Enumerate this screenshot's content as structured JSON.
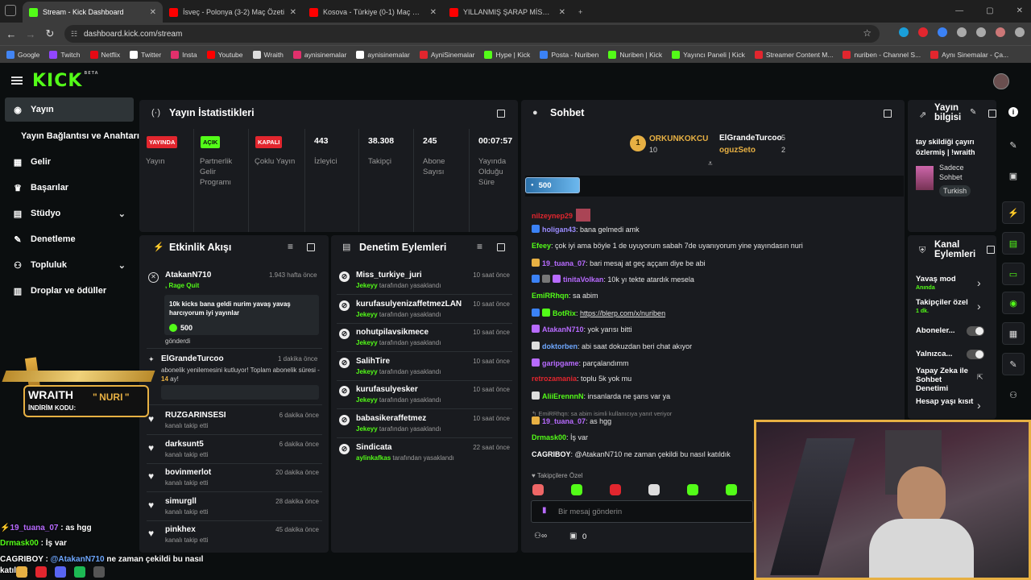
{
  "browser": {
    "tabs": [
      {
        "title": "Stream - Kick Dashboard",
        "active": true,
        "favicon": "kick-icon",
        "color": "#53fc18"
      },
      {
        "title": "İsveç - Polonya (3-2) Maç Özeti",
        "active": false,
        "favicon": "youtube-icon",
        "color": "#ff0000"
      },
      {
        "title": "Kosova - Türkiye (0-1) Maç Özeti",
        "active": false,
        "favicon": "youtube-icon",
        "color": "#ff0000"
      },
      {
        "title": "YILLANMIŞ ŞARAP MİSALİ.. | LOL",
        "active": false,
        "favicon": "youtube-icon",
        "color": "#ff0000"
      }
    ],
    "url": "dashboard.kick.com/stream",
    "bookmarks": [
      "Google",
      "Twitch",
      "Netflix",
      "Twitter",
      "Insta",
      "Youtube",
      "Wraith",
      "aynisinemalar",
      "aynisinemalar",
      "AyniSinemalar",
      "Hype | Kick",
      "Posta - Nuriben",
      "Nuriben | Kick",
      "Yayıncı Paneli | Kick",
      "Streamer Content M...",
      "nuriben - Channel S...",
      "Aynı Sinemalar - Ça..."
    ]
  },
  "kick": {
    "logo": "KICK",
    "logo_tag": "BETA",
    "accent": "#53fc18"
  },
  "sidebar": {
    "items": [
      {
        "label": "Yayın",
        "icon": "broadcast-icon",
        "active": true
      },
      {
        "label": "Yayın Bağlantısı ve Anahtarı",
        "icon": "",
        "active": false
      },
      {
        "label": "Gelir",
        "icon": "dollar-icon",
        "active": false
      },
      {
        "label": "Başarılar",
        "icon": "trophy-icon",
        "active": false
      },
      {
        "label": "Stüdyo",
        "icon": "studio-icon",
        "active": false,
        "chevron": true
      },
      {
        "label": "Denetleme",
        "icon": "wrench-icon",
        "active": false
      },
      {
        "label": "Topluluk",
        "icon": "community-icon",
        "active": false,
        "chevron": true
      },
      {
        "label": "Droplar ve ödüller",
        "icon": "drops-icon",
        "active": false
      }
    ]
  },
  "stats": {
    "title": "Yayın İstatistikleri",
    "cols": [
      {
        "value": "YAYINDA",
        "label": "Yayın",
        "type": "badge",
        "color": "#e2262e"
      },
      {
        "value": "AÇIK",
        "label": "Partnerlik Gelir Programı",
        "type": "badge",
        "color": "#53fc18"
      },
      {
        "value": "KAPALI",
        "label": "Çoklu Yayın",
        "type": "badge",
        "color": "#e2262e"
      },
      {
        "value": "443",
        "label": "İzleyici",
        "type": "num"
      },
      {
        "value": "38.308",
        "label": "Takipçi",
        "type": "num"
      },
      {
        "value": "245",
        "label": "Abone Sayısı",
        "type": "num"
      },
      {
        "value": "00:07:57",
        "label": "Yayında Olduğu Süre",
        "type": "num"
      }
    ]
  },
  "activity": {
    "title": "Etkinlik Akışı",
    "items": [
      {
        "name": "AtakanN710",
        "time": "1.943 hafta önce",
        "sub": ", Rage Quit",
        "msg": "10k kicks bana geldi nurim yavaş yavaş harcıyorum iyi yayınlar",
        "amount": "500",
        "footer": "gönderdi"
      },
      {
        "name": "ElGrandeTurcoo",
        "time": "1 dakika önce",
        "sub": "abonelik yenilemesini kutluyor! Toplam abonelik süresi - ",
        "months": "14",
        "months_suffix": " ay!"
      },
      {
        "name": "RUZGARINSESI",
        "time": "6 dakika önce",
        "sub": "kanalı takip etti"
      },
      {
        "name": "darksunt5",
        "time": "6 dakika önce",
        "sub": "kanalı takip etti"
      },
      {
        "name": "bovinmerlot",
        "time": "20 dakika önce",
        "sub": "kanalı takip etti"
      },
      {
        "name": "simurgll",
        "time": "28 dakika önce",
        "sub": "kanalı takip etti"
      },
      {
        "name": "pinkhex",
        "time": "45 dakika önce",
        "sub": "kanalı takip etti"
      }
    ]
  },
  "moderation": {
    "title": "Denetim Eylemleri",
    "items": [
      {
        "name": "Miss_turkiye_juri",
        "time": "10 saat önce",
        "by": "Jekeyy",
        "action": " tarafından yasaklandı"
      },
      {
        "name": "kurufasulyenizaffetmezLAN",
        "time": "10 saat önce",
        "by": "Jekeyy",
        "action": " tarafından yasaklandı"
      },
      {
        "name": "nohutpilavsikmece",
        "time": "10 saat önce",
        "by": "Jekeyy",
        "action": " tarafından yasaklandı"
      },
      {
        "name": "SalihTire",
        "time": "10 saat önce",
        "by": "Jekeyy",
        "action": " tarafından yasaklandı"
      },
      {
        "name": "kurufasulyesker",
        "time": "10 saat önce",
        "by": "Jekeyy",
        "action": " tarafından yasaklandı"
      },
      {
        "name": "babasikeraffetmez",
        "time": "10 saat önce",
        "by": "Jekeyy",
        "action": " tarafından yasaklandı"
      },
      {
        "name": "Sindicata",
        "time": "22 saat önce",
        "by": "aylinkafkas",
        "action": " tarafından yasaklandı"
      }
    ]
  },
  "chat": {
    "title": "Sohbet",
    "leaders": [
      {
        "rank": "1",
        "name": "ORKUNKOKCU",
        "count": "10"
      },
      {
        "name": "ElGrandeTurcoo",
        "count": "5"
      },
      {
        "name": "oguzSeto",
        "count": "2"
      }
    ],
    "pinned_amount": "500",
    "messages": [
      {
        "user": "nilzeynep29",
        "color": "#e2262e",
        "text": ""
      },
      {
        "user": "holigan43",
        "color": "#9b8cff",
        "text": "bana gelmedi amk"
      },
      {
        "user": "Efeey",
        "color": "#53fc18",
        "text": "çok iyi ama böyle 1 de uyuyorum sabah 7de uyanıyorum yine yayındasın nuri"
      },
      {
        "user": "19_tuana_07",
        "color": "#b86bff",
        "text": "bari mesaj at geç aççam diye be abi"
      },
      {
        "user": "tinitaVolkan",
        "color": "#b86bff",
        "text": "10k yı tekte atardık mesela"
      },
      {
        "user": "EmiRRhqn",
        "color": "#53fc18",
        "text": "sa abim"
      },
      {
        "user": "BotRix",
        "color": "#53fc18",
        "text": "https://blerp.com/x/nuriben"
      },
      {
        "user": "AtakanN710",
        "color": "#b86bff",
        "text": "yok yarısı bitti"
      },
      {
        "user": "doktorben",
        "color": "#6fa8ff",
        "text": "abi saat dokuzdan beri chat akıyor"
      },
      {
        "user": "garipgame",
        "color": "#b86bff",
        "text": "parçalandımm"
      },
      {
        "user": "retrozamania",
        "color": "#e2262e",
        "text": "toplu 5k yok mu"
      },
      {
        "user": "AliiErennnN",
        "color": "#53fc18",
        "text": "insanlarda ne şans var ya"
      },
      {
        "user": "19_tuana_07",
        "color": "#b86bff",
        "text": "as hgg",
        "reply": "EmiRRhqn: sa abim isimli kullanıcıya yanıt veriyor"
      },
      {
        "user": "Drmask00",
        "color": "#53fc18",
        "text": "İş var"
      },
      {
        "user": "CAGRIBOY",
        "color": "#ffffff",
        "text": "@AtakanN710 ne zaman çekildi bu nasıl katıldık"
      }
    ],
    "followers_only": "Takipçilere Özel",
    "input_placeholder": "Bir mesaj gönderin",
    "footer_count": "0"
  },
  "streaminfo": {
    "title": "Yayın bilgisi",
    "stream_title": "tay skildiği çayırı özlermiş | !wraith",
    "category": "Sadece Sohbet",
    "language": "Turkish"
  },
  "channel_actions": {
    "title": "Kanal Eylemleri",
    "items": [
      {
        "label": "Yavaş mod",
        "sub": "Anında",
        "control": "chevron"
      },
      {
        "label": "Takipçiler özel",
        "sub": "1 dk.",
        "control": "chevron"
      },
      {
        "label": "Aboneler...",
        "control": "toggle"
      },
      {
        "label": "Yalnızca...",
        "control": "toggle"
      },
      {
        "label": "Yapay Zeka ile Sohbet Denetimi",
        "control": "external"
      },
      {
        "label": "Hesap yaşı kısıt",
        "control": "chevron"
      }
    ]
  },
  "overlay": {
    "promo_brand": "WRAITH",
    "promo_code_label": "İNDİRİM KODU:",
    "promo_code": "NURI",
    "lines": [
      {
        "user": "19_tuana_07",
        "text": "as hgg"
      },
      {
        "user": "Drmask00",
        "text": "İş var"
      },
      {
        "user": "CAGRIBOY",
        "text": "@AtakanN710 ne zaman çekildi bu nasıl katıldık"
      }
    ]
  }
}
